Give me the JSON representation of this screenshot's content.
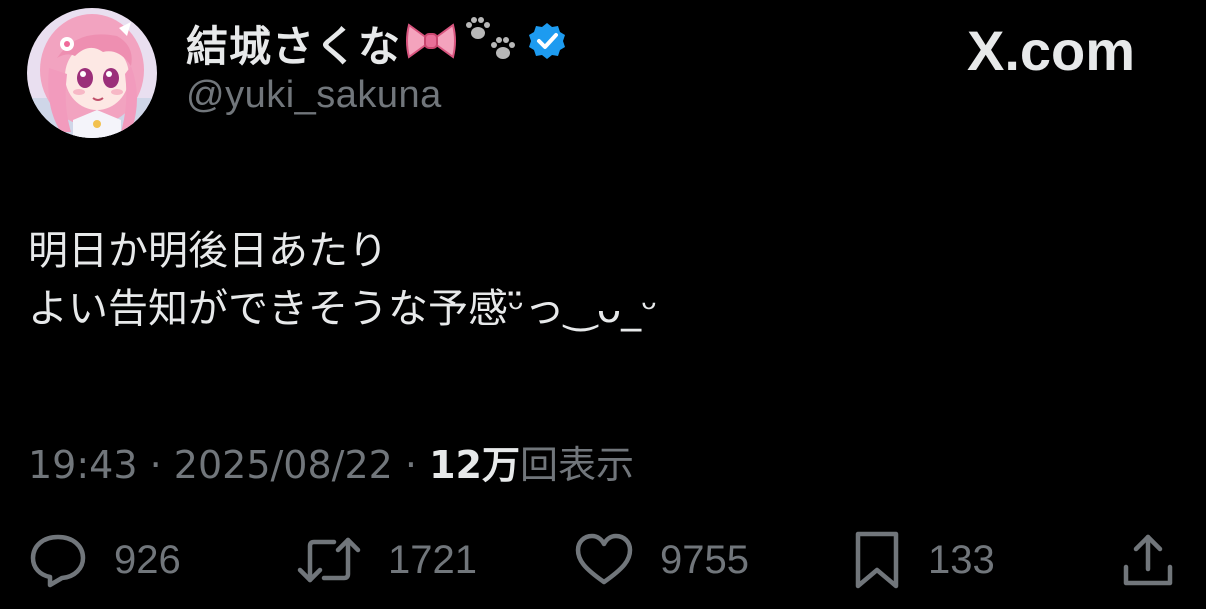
{
  "author": {
    "display_name": "結城さくな",
    "handle": "@yuki_sakuna",
    "verified": true
  },
  "brand": {
    "logo_text": "X.com"
  },
  "tweet": {
    "lines": [
      "明日か明後日あたり",
      "よい告知ができそうな予感ᵕ̈っ‿ᴗ_ᵕ"
    ]
  },
  "meta": {
    "time": "19:43",
    "separator": "·",
    "date": "2025/08/22",
    "views_count": "12万",
    "views_label": "回表示"
  },
  "actions": {
    "reply_count": "926",
    "repost_count": "1721",
    "like_count": "9755",
    "bookmark_count": "133"
  },
  "colors": {
    "background": "#000000",
    "text_primary": "#e7e9ea",
    "text_secondary": "#71767b",
    "verified_badge": "#1d9bf0",
    "avatar_hair": "#f2a3c0"
  },
  "icons": {
    "bow": "pink-ribbon-bow-icon",
    "paws": "paw-prints-icon",
    "verified": "verified-badge-icon",
    "reply": "speech-bubble-icon",
    "repost": "repost-arrows-icon",
    "like": "heart-icon",
    "bookmark": "bookmark-icon",
    "share": "share-upload-icon"
  }
}
